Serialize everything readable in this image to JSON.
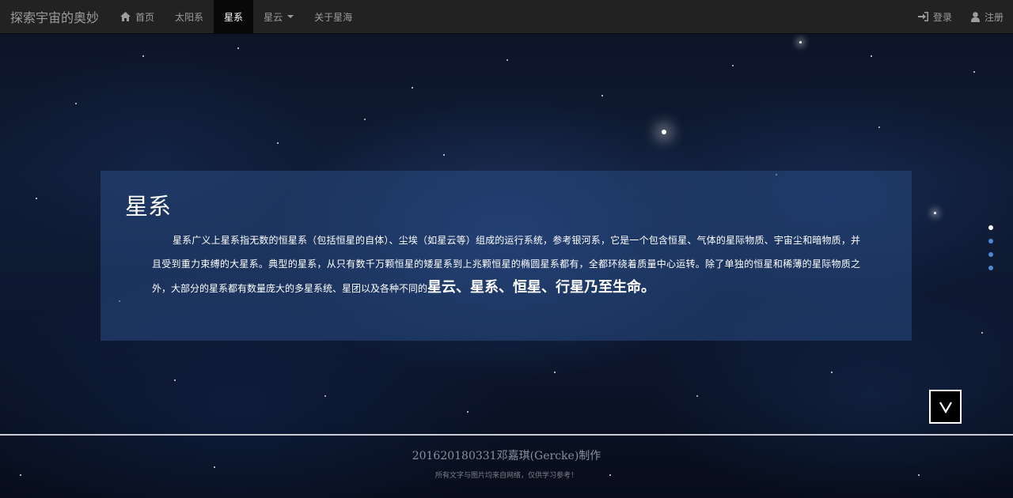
{
  "navbar": {
    "brand": "探索宇宙的奥妙",
    "items": [
      {
        "label": "首页",
        "icon": "home-icon"
      },
      {
        "label": "太阳系"
      },
      {
        "label": "星系",
        "active": true
      },
      {
        "label": "星云",
        "dropdown": true
      },
      {
        "label": "关于星海"
      }
    ],
    "right": [
      {
        "label": "登录",
        "icon": "login-icon"
      },
      {
        "label": "注册",
        "icon": "user-icon"
      }
    ]
  },
  "panel": {
    "title": "星系",
    "text": "星系广义上星系指无数的恒星系（包括恒星的自体）、尘埃（如星云等）组成的运行系统，参考银河系，它是一个包含恒星、气体的星际物质、宇宙尘和暗物质，并且受到重力束缚的大星系。典型的星系，从只有数千万颗恒星的矮星系到上兆颗恒星的椭圆星系都有，全都环绕着质量中心运转。除了单独的恒星和稀薄的星际物质之外，大部分的星系都有数量庞大的多星系统、星团以及各种不同的",
    "emphasis": "星云、星系、恒星、行星乃至生命。"
  },
  "side_dots": {
    "count": 4,
    "active_index": 0
  },
  "down_button": {
    "label": "V"
  },
  "footer": {
    "main": "201620180331邓嘉琪(Gercke)制作",
    "note": "所有文字与图片均来自网络，仅供学习参考！"
  },
  "colors": {
    "navbar_bg": "#222222",
    "active_bg": "#080808",
    "panel_bg": "#284b82",
    "dot_active": "#ffffff",
    "dot_inactive": "#4a8ad8"
  }
}
